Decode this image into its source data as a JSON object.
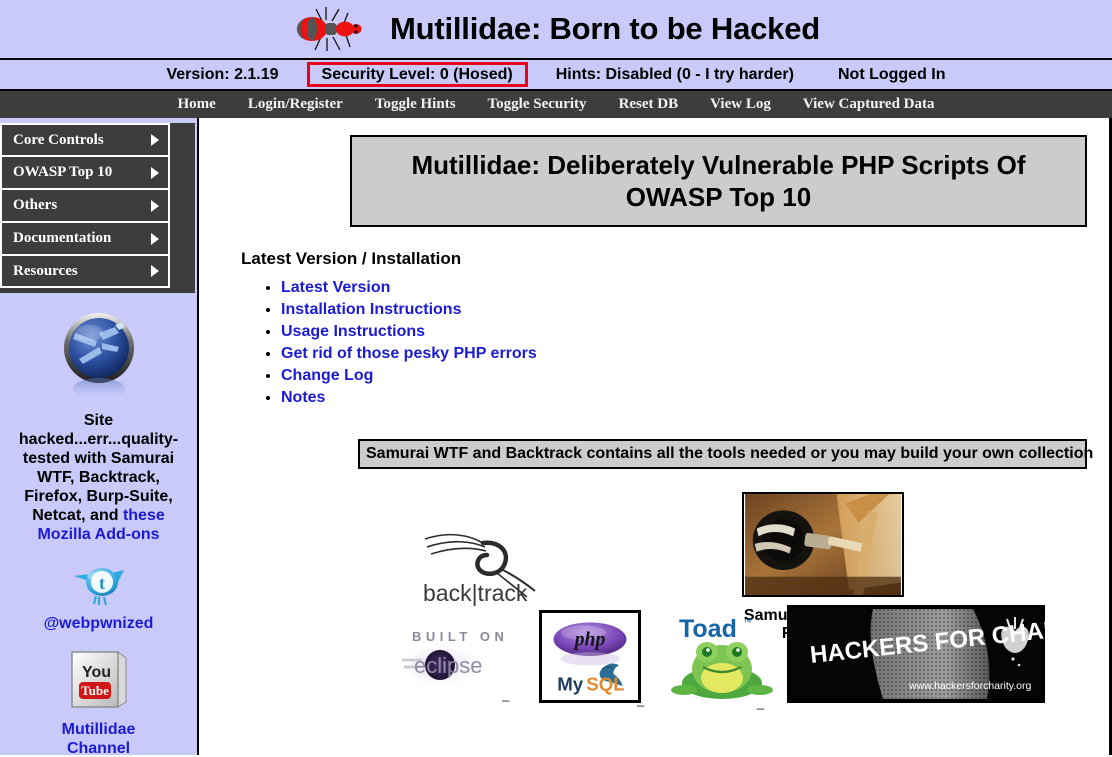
{
  "banner": {
    "title": "Mutillidae: Born to be Hacked",
    "logo_icon": "velvet-ant-icon"
  },
  "status": {
    "version": "Version: 2.1.19",
    "security_level": "Security Level: 0 (Hosed)",
    "hints": "Hints: Disabled (0 - I try harder)",
    "login": "Not Logged In",
    "flag_color": "#e8001c"
  },
  "nav": {
    "items": [
      {
        "label": "Home"
      },
      {
        "label": "Login/Register"
      },
      {
        "label": "Toggle Hints"
      },
      {
        "label": "Toggle Security"
      },
      {
        "label": "Reset DB"
      },
      {
        "label": "View Log"
      },
      {
        "label": "View Captured Data"
      }
    ]
  },
  "sidebar": {
    "menu": [
      {
        "label": "Core Controls",
        "arrow": "chevron-right-icon"
      },
      {
        "label": "OWASP Top 10",
        "arrow": "chevron-right-icon"
      },
      {
        "label": "Others",
        "arrow": "chevron-right-icon"
      },
      {
        "label": "Documentation",
        "arrow": "chevron-right-icon"
      },
      {
        "label": "Resources",
        "arrow": "chevron-right-icon"
      }
    ],
    "samurai_logo_icon": "samurai-wtf-orb-icon",
    "promo_text_plain": "Site hacked...err...quality-tested with Samurai WTF, Backtrack, Firefox, Burp-Suite, Netcat, and ",
    "promo_line1": "Site",
    "promo_line2": "hacked...err...quality-",
    "promo_line3": "tested with Samurai",
    "promo_line4": "WTF, Backtrack,",
    "promo_line5": "Firefox, Burp-Suite,",
    "promo_line6": "Netcat, and ",
    "promo_link_a": "these",
    "promo_link_b": "Mozilla Add-ons",
    "twitter_icon": "twitter-bird-icon",
    "twitter_handle": "@webpwnized",
    "youtube_icon": "youtube-icon",
    "youtube_line1": "Mutillidae",
    "youtube_line2": "Channel"
  },
  "main": {
    "page_title": "Mutillidae: Deliberately Vulnerable PHP Scripts Of OWASP Top 10",
    "section_heading": "Latest Version / Installation",
    "links": [
      {
        "label": "Latest Version"
      },
      {
        "label": "Installation Instructions"
      },
      {
        "label": "Usage Instructions"
      },
      {
        "label": "Get rid of those pesky PHP errors"
      },
      {
        "label": "Change Log"
      },
      {
        "label": "Notes"
      }
    ],
    "tools_banner": "Samurai WTF and Backtrack contains all the tools needed or you may build your own collection",
    "logos": {
      "backtrack": {
        "icon": "backtrack-logo-icon",
        "text": "back|track",
        "text_left": "back",
        "text_right": "track"
      },
      "samurai": {
        "icon": "samurai-sword-photo",
        "caption": "Samurai Web Testing Framework"
      },
      "eclipse": {
        "icon": "eclipse-logo-icon",
        "tagline": "BUILT ON",
        "name": "eclipse"
      },
      "phpmysql": {
        "icon": "php-mysql-logo-icon",
        "php": "php",
        "mysql_my": "My",
        "mysql_sql": "SQL"
      },
      "toad": {
        "icon": "toad-logo-icon",
        "name": "Toad",
        "tm": "™"
      },
      "hfc": {
        "icon": "hackers-for-charity-banner",
        "headline": "HACKERS FOR CHARITY",
        "url": "www.hackersforcharity.org"
      }
    }
  },
  "colors": {
    "page_bg": "#ffffff",
    "banner_bg": "#c9c9fa",
    "nav_bg": "#3d3d3d",
    "menu_bg": "#3d3d3d",
    "link_blue": "#1b1bd4",
    "title_box_bg": "#cccccc"
  }
}
